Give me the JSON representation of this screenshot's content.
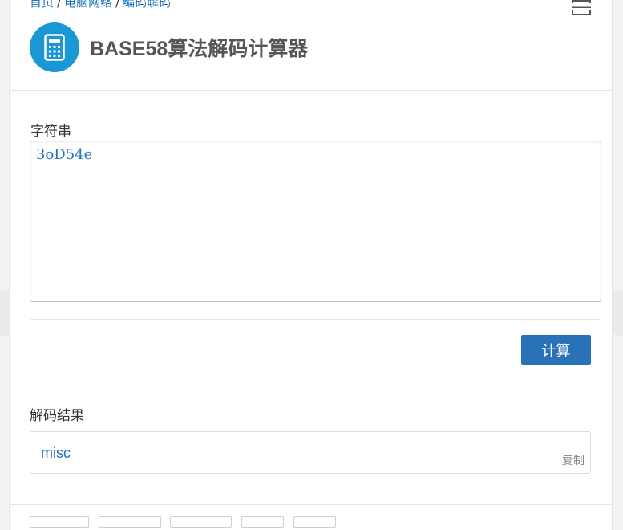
{
  "breadcrumb": {
    "home": "首页",
    "separator": "/",
    "category": "电脑网络",
    "subcategory": "编码解码"
  },
  "header": {
    "title": "BASE58算法解码计算器",
    "icon": "calculator-icon",
    "menu_icon": "menu-icon"
  },
  "form": {
    "input_label": "字符串",
    "input_value": "3oD54e",
    "calculate_label": "计算"
  },
  "result": {
    "label": "解码结果",
    "value": "misc",
    "copy_label": "复制"
  },
  "colors": {
    "accent": "#2a72b8",
    "icon_bg": "#1a97d5",
    "link": "#1e73be"
  }
}
